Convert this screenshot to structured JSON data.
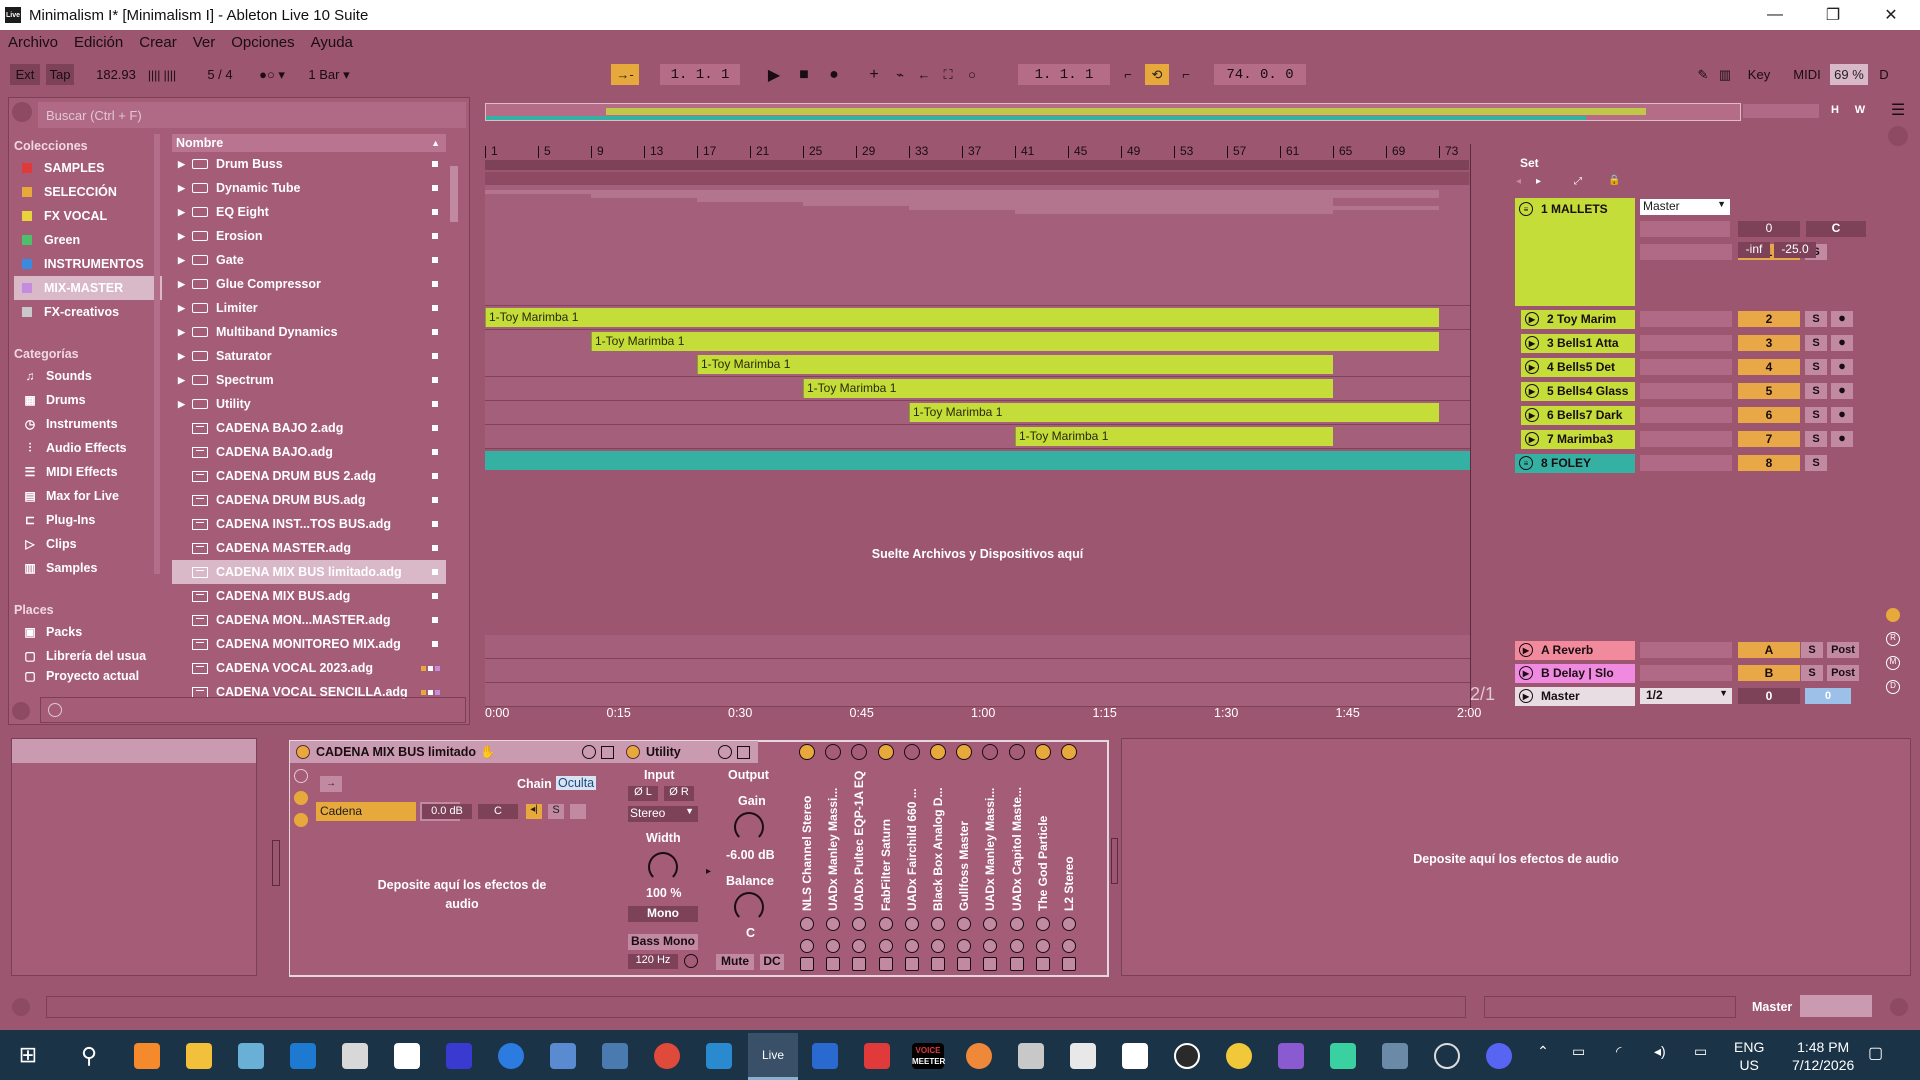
{
  "window": {
    "title": "Minimalism I*  [Minimalism I] - Ableton Live 10 Suite",
    "logo_text": "Live",
    "controls": [
      "—",
      "❐",
      "✕"
    ]
  },
  "menu": [
    "Archivo",
    "Edición",
    "Crear",
    "Ver",
    "Opciones",
    "Ayuda"
  ],
  "transport": {
    "ext": "Ext",
    "tap": "Tap",
    "tempo": "182.93",
    "signature": "5 / 4",
    "metro": "●○ ▾",
    "quantize": "1 Bar ▾",
    "position": "1.  1.  1",
    "loop_start": "1.  1.  1",
    "loop_length": "74.  0.  0",
    "key": "Key",
    "midi": "MIDI",
    "cpu": "69 %",
    "d": "D"
  },
  "browser": {
    "search_placeholder": "Buscar (Ctrl + F)",
    "collections_title": "Colecciones",
    "collections": [
      {
        "label": "SAMPLES",
        "color": "#e03a3a"
      },
      {
        "label": "SELECCIÓN",
        "color": "#e8a93c"
      },
      {
        "label": "FX VOCAL",
        "color": "#e8d33c"
      },
      {
        "label": "Green",
        "color": "#4ec06a"
      },
      {
        "label": "INSTRUMENTOS",
        "color": "#3a8ae0"
      },
      {
        "label": "MIX-MASTER",
        "color": "#c58be0"
      },
      {
        "label": "FX-creativos",
        "color": "#c9c9c9"
      }
    ],
    "categories_title": "Categorías",
    "categories": [
      {
        "label": "Sounds",
        "icon": "♫"
      },
      {
        "label": "Drums",
        "icon": "▦"
      },
      {
        "label": "Instruments",
        "icon": "◷"
      },
      {
        "label": "Audio Effects",
        "icon": "⫶"
      },
      {
        "label": "MIDI Effects",
        "icon": "☰"
      },
      {
        "label": "Max for Live",
        "icon": "▤"
      },
      {
        "label": "Plug-Ins",
        "icon": "⊏"
      },
      {
        "label": "Clips",
        "icon": "▷"
      },
      {
        "label": "Samples",
        "icon": "▥"
      }
    ],
    "places_title": "Places",
    "places": [
      {
        "label": "Packs",
        "icon": "▣"
      },
      {
        "label": "Librería del usua",
        "icon": "▢"
      },
      {
        "label": "Proyecto actual",
        "icon": "▢"
      }
    ],
    "list_header": "Nombre",
    "files": [
      {
        "name": "Drum Buss",
        "type": "folder"
      },
      {
        "name": "Dynamic Tube",
        "type": "folder"
      },
      {
        "name": "EQ Eight",
        "type": "folder"
      },
      {
        "name": "Erosion",
        "type": "folder"
      },
      {
        "name": "Gate",
        "type": "folder"
      },
      {
        "name": "Glue Compressor",
        "type": "folder"
      },
      {
        "name": "Limiter",
        "type": "folder"
      },
      {
        "name": "Multiband Dynamics",
        "type": "folder"
      },
      {
        "name": "Saturator",
        "type": "folder"
      },
      {
        "name": "Spectrum",
        "type": "folder"
      },
      {
        "name": "Utility",
        "type": "folder"
      },
      {
        "name": "CADENA BAJO 2.adg",
        "type": "adg"
      },
      {
        "name": "CADENA BAJO.adg",
        "type": "adg"
      },
      {
        "name": "CADENA DRUM BUS 2.adg",
        "type": "adg"
      },
      {
        "name": "CADENA DRUM BUS.adg",
        "type": "adg"
      },
      {
        "name": "CADENA INST...TOS BUS.adg",
        "type": "adg"
      },
      {
        "name": "CADENA MASTER.adg",
        "type": "adg"
      },
      {
        "name": "CADENA MIX BUS limitado.adg",
        "type": "adg",
        "selected": true
      },
      {
        "name": "CADENA MIX BUS.adg",
        "type": "adg"
      },
      {
        "name": "CADENA MON...MASTER.adg",
        "type": "adg"
      },
      {
        "name": "CADENA MONITOREO MIX.adg",
        "type": "adg"
      },
      {
        "name": "CADENA VOCAL 2023.adg",
        "type": "adg",
        "multi": true
      },
      {
        "name": "CADENA VOCAL SENCILLA.adg",
        "type": "adg",
        "multi": true
      }
    ]
  },
  "arrangement": {
    "bars": [
      "1",
      "5",
      "9",
      "13",
      "17",
      "21",
      "25",
      "29",
      "33",
      "37",
      "41",
      "45",
      "49",
      "53",
      "57",
      "61",
      "65",
      "69",
      "73"
    ],
    "clip_name": "1-Toy Marimba 1",
    "drop_text": "Suelte Archivos y Dispositivos aquí",
    "time_marks": [
      "0:00",
      "0:15",
      "0:30",
      "0:45",
      "1:00",
      "1:15",
      "1:30",
      "1:45",
      "2:00"
    ],
    "fraction": "2/1",
    "hw": [
      "H",
      "W"
    ]
  },
  "mixer": {
    "set_label": "Set",
    "tracks": [
      {
        "name": "1 MALLETS",
        "num": "1",
        "color": "#c4dd38",
        "group": true
      },
      {
        "name": "2 Toy Marim",
        "num": "2",
        "color": "#c4dd38"
      },
      {
        "name": "3 Bells1 Atta",
        "num": "3",
        "color": "#c4dd38"
      },
      {
        "name": "4 Bells5 Det",
        "num": "4",
        "color": "#c4dd38"
      },
      {
        "name": "5 Bells4 Glass",
        "num": "5",
        "color": "#c4dd38"
      },
      {
        "name": "6 Bells7 Dark",
        "num": "6",
        "color": "#c4dd38"
      },
      {
        "name": "7 Marimba3",
        "num": "7",
        "color": "#c4dd38"
      },
      {
        "name": "8 FOLEY",
        "num": "8",
        "color": "#34b1a3",
        "group": true
      }
    ],
    "returns": [
      {
        "name": "A Reverb",
        "num": "A",
        "color": "#f08a9c",
        "post": "Post"
      },
      {
        "name": "B Delay | Slo",
        "num": "B",
        "color": "#f08ae0",
        "post": "Post"
      }
    ],
    "master": {
      "name": "Master",
      "route": "1/2",
      "vol": "0",
      "pan": "0"
    },
    "group_routing": "Master",
    "group_vol": "0",
    "group_pan": "C",
    "group_inf": "-inf",
    "group_db": "-25.0",
    "solo": "S"
  },
  "devices": {
    "rack_name": "CADENA MIX BUS limitado",
    "chain_label": "Chain",
    "chain_state": "Oculta",
    "chain_name": "Cadena",
    "chain_vol": "0.0 dB",
    "chain_pan": "C",
    "drop_effects": "Deposite aquí los efectos de audio",
    "utility": {
      "title": "Utility",
      "input": "Input",
      "output": "Output",
      "phase_l": "Ø L",
      "phase_r": "Ø R",
      "mode": "Stereo",
      "width_label": "Width",
      "width": "100 %",
      "mono": "Mono",
      "bass_mono": "Bass Mono",
      "bass_freq": "120 Hz",
      "gain_label": "Gain",
      "gain": "-6.00 dB",
      "balance_label": "Balance",
      "balance": "C",
      "mute": "Mute",
      "dc": "DC"
    },
    "macros": [
      {
        "label": "NLS Channel Stereo",
        "color": "#e8a93c"
      },
      {
        "label": "UADx Manley Massi...",
        "color": "#a45c77"
      },
      {
        "label": "UADx Pultec EQP-1A EQ",
        "color": "#a45c77"
      },
      {
        "label": "FabFilter Saturn",
        "color": "#e8a93c"
      },
      {
        "label": "UADx Fairchild 660 ...",
        "color": "#a45c77"
      },
      {
        "label": "Black Box Analog D...",
        "color": "#e8a93c"
      },
      {
        "label": "Gullfoss Master",
        "color": "#e8a93c"
      },
      {
        "label": "UADx Manley Massi...",
        "color": "#a45c77"
      },
      {
        "label": "UADx Capitol Maste...",
        "color": "#a45c77"
      },
      {
        "label": "The God Particle",
        "color": "#e8a93c"
      },
      {
        "label": "L2 Stereo",
        "color": "#e8a93c"
      }
    ],
    "right_drop": "Deposite aquí los efectos de audio"
  },
  "status": {
    "master_label": "Master"
  },
  "taskbar": {
    "lang1": "ENG",
    "lang2": "US",
    "time": "1:48 PM",
    "date": "7/12/2026",
    "voicemeeter_top": "VOICE",
    "voicemeeter_bottom": "MEETER",
    "live_label": "Live"
  }
}
